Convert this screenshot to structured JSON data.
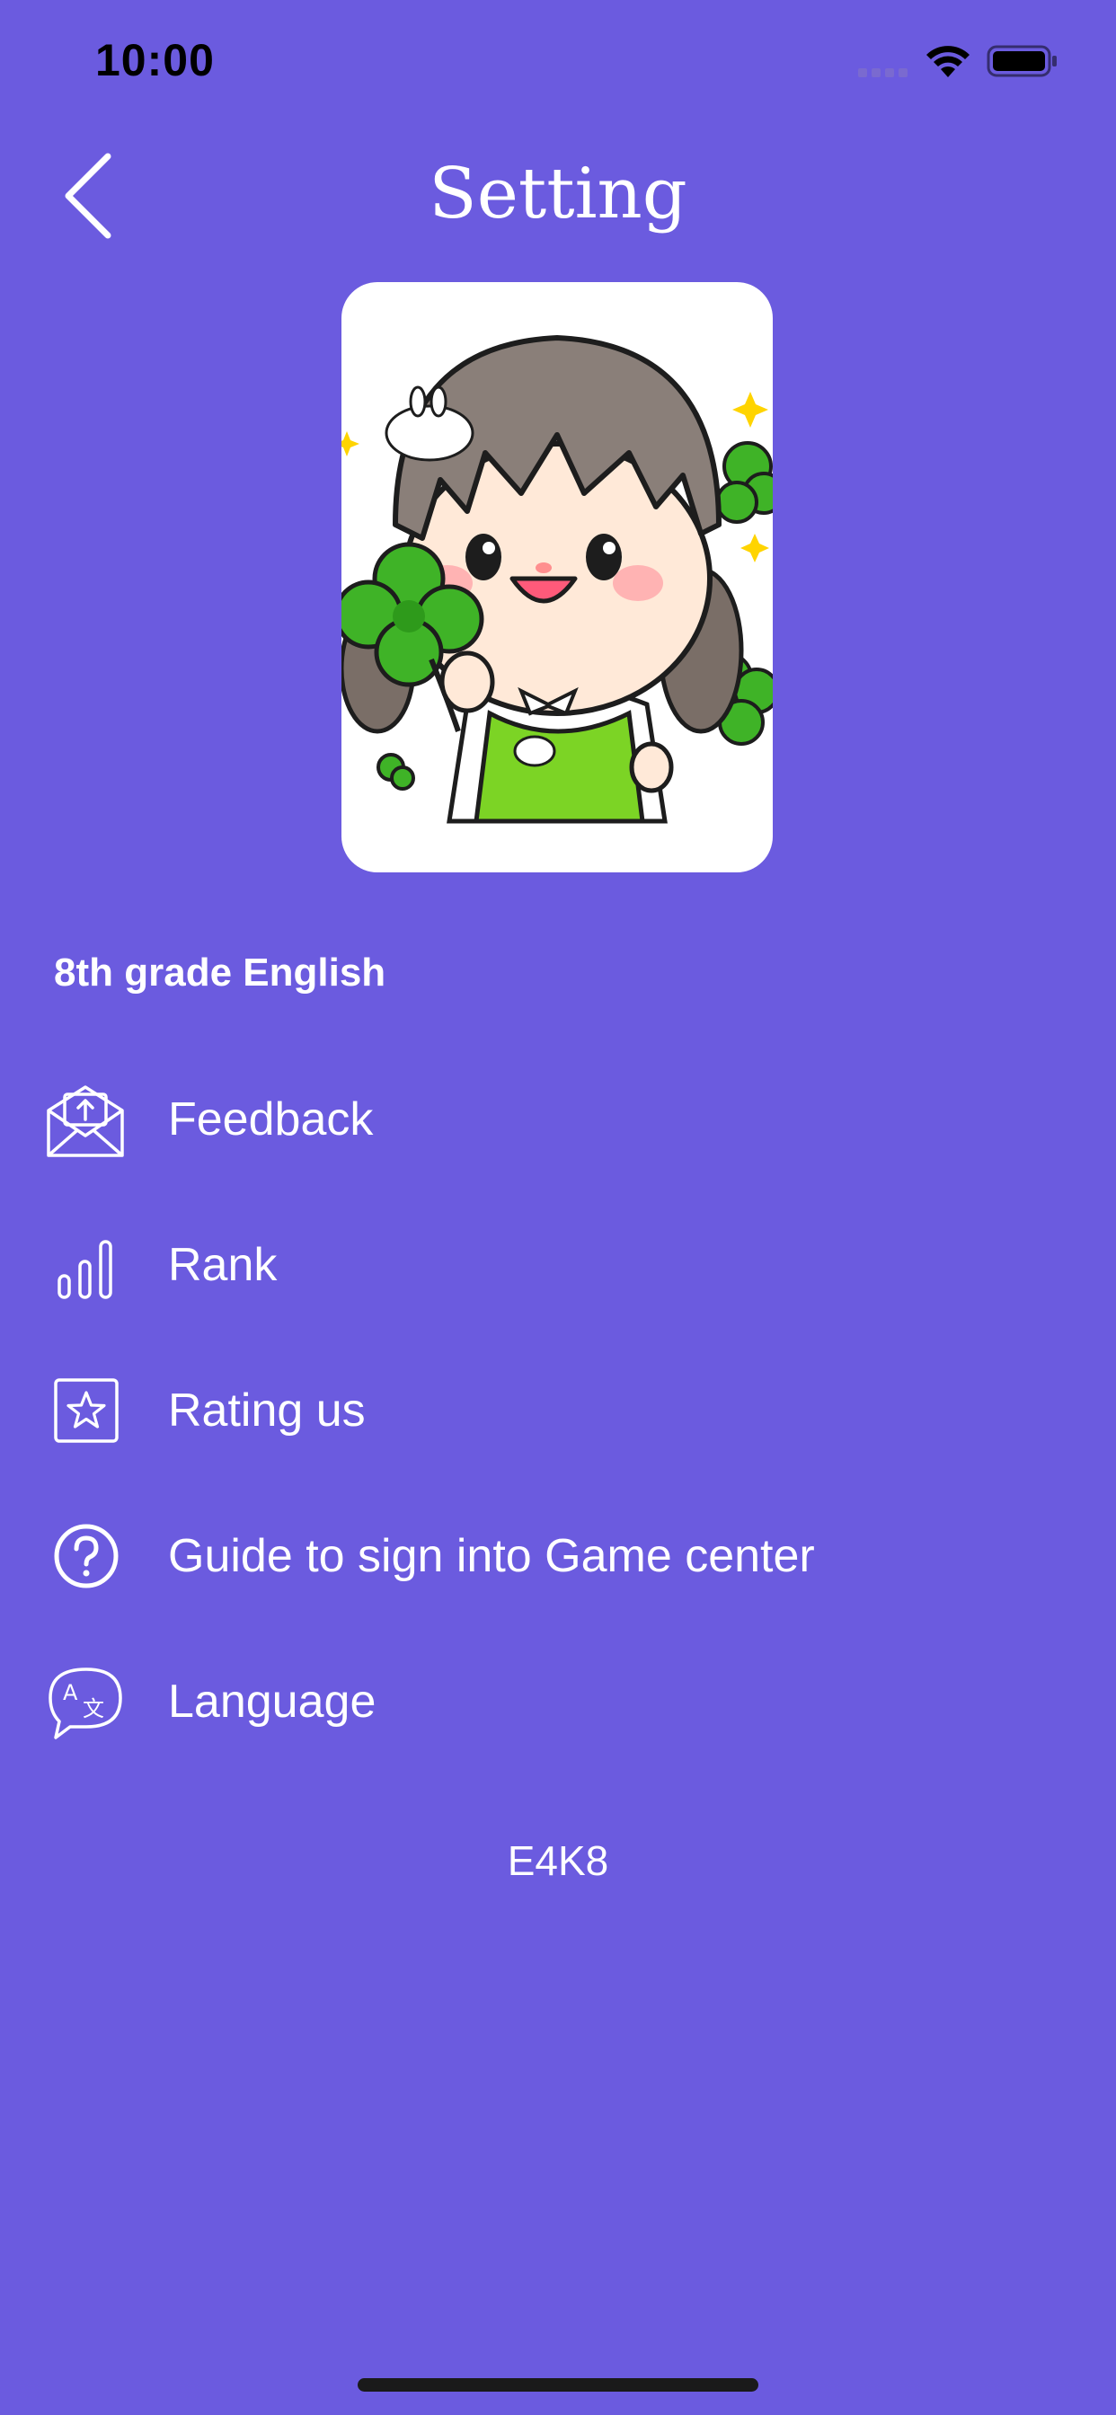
{
  "status_bar": {
    "time": "10:00"
  },
  "header": {
    "title": "Setting",
    "back_icon": "chevron-left-icon"
  },
  "avatar": {
    "description_icon": "cartoon-girl-clover-avatar"
  },
  "subject": {
    "label": "8th grade English"
  },
  "menu": {
    "items": [
      {
        "label": "Feedback",
        "icon": "mail-upload-icon"
      },
      {
        "label": "Rank",
        "icon": "bar-chart-icon"
      },
      {
        "label": "Rating us",
        "icon": "star-box-icon"
      },
      {
        "label": "Guide to sign into Game center",
        "icon": "question-circle-icon"
      },
      {
        "label": "Language",
        "icon": "translate-bubble-icon"
      }
    ]
  },
  "footer": {
    "code": "E4K8"
  },
  "colors": {
    "background": "#6b5bdf",
    "text": "#ffffff",
    "card": "#ffffff"
  }
}
